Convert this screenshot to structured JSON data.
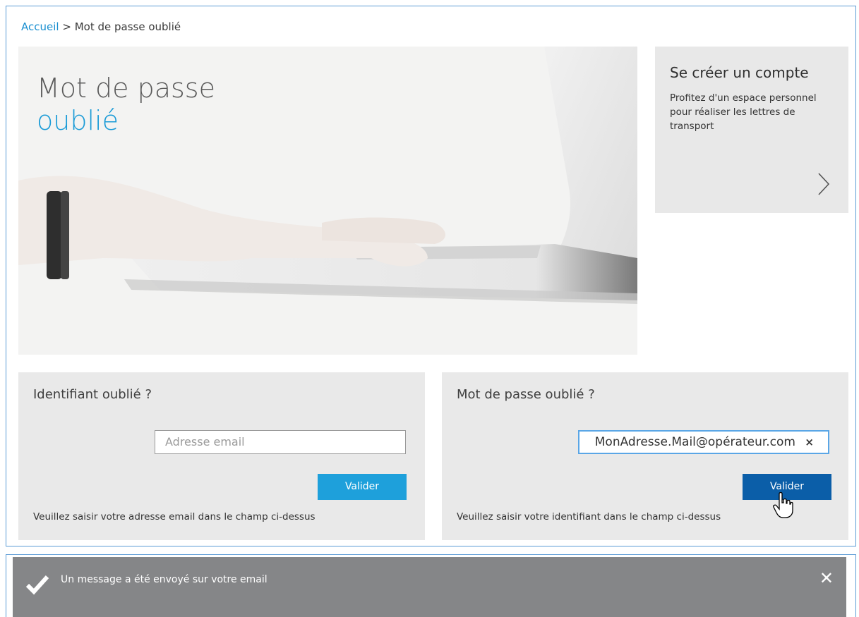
{
  "breadcrumb": {
    "home": "Accueil",
    "separator": ">",
    "current": "Mot de passe oublié"
  },
  "hero": {
    "title_line1": "Mot de passe",
    "title_line2": "oublié"
  },
  "create_account": {
    "title": "Se créer un compte",
    "text": "Profitez d'un espace personnel pour réaliser les lettres de transport",
    "arrow_icon": "chevron-right-icon"
  },
  "identifiant": {
    "title": "Identifiant oublié ?",
    "placeholder": "Adresse email",
    "button": "Valider",
    "hint": "Veuillez saisir votre adresse email dans le champ ci-dessus"
  },
  "password": {
    "title": "Mot de passe oublié ?",
    "value": "MonAdresse.Mail@opérateur.com",
    "clear": "×",
    "button": "Valider",
    "hint": "Veuillez saisir votre identifiant dans le champ ci-dessus"
  },
  "toast": {
    "message": "Un message a été envoyé sur votre email",
    "close": "✕"
  },
  "colors": {
    "accent": "#1a9bd7",
    "button_primary": "#1ea0db",
    "button_active": "#0b5ea8",
    "toast_bg": "#858688"
  }
}
